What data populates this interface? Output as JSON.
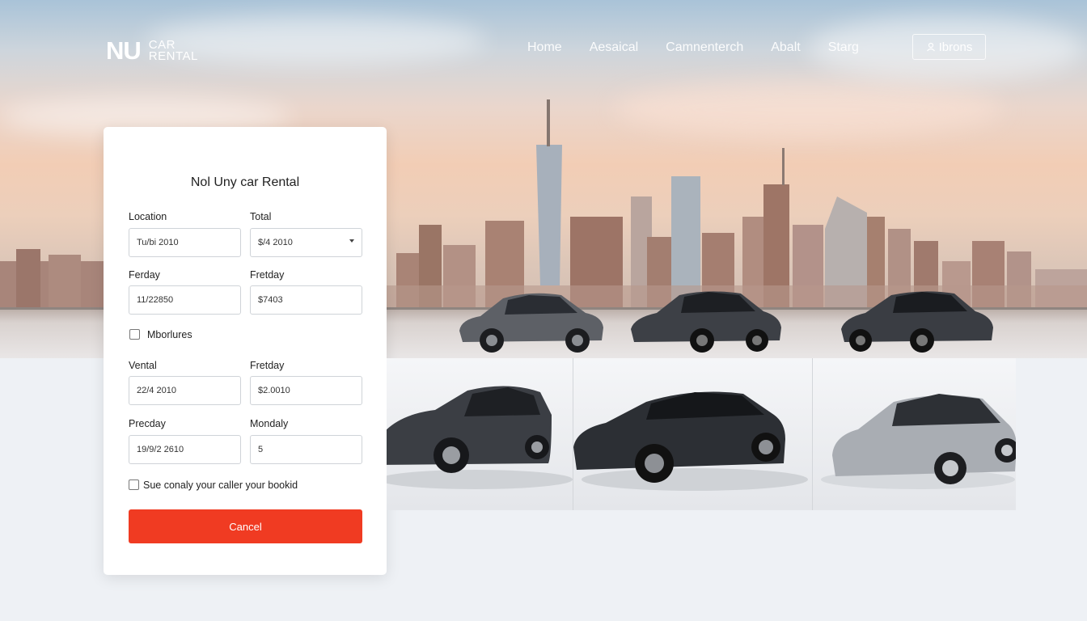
{
  "brand": {
    "mark": "NU",
    "name_line1": "CAR",
    "name_line2": "RENTAL"
  },
  "nav": {
    "items": [
      "Home",
      "Aesaical",
      "Camnenterch",
      "Abalt",
      "Starg"
    ],
    "action": "Ibrons",
    "action_icon": "user-icon"
  },
  "booking": {
    "title": "Nol Uny car Rental",
    "fields": [
      {
        "label": "Location",
        "value": "Tu/bi 2010"
      },
      {
        "label": "Total",
        "value": "$/4 2010",
        "icon": "chevron-down-icon"
      },
      {
        "label": "Ferday",
        "value": "11/22850"
      },
      {
        "label": "Fretday",
        "value": "$7403"
      },
      {
        "label": "Vental",
        "value": "22/4 2010"
      },
      {
        "label": "Fretday",
        "value": "$2.0010"
      },
      {
        "label": "Precday",
        "value": "19/9/2 2610"
      },
      {
        "label": "Mondaly",
        "value": "5"
      }
    ],
    "checkbox_1": {
      "label": "Mborlures",
      "checked": false
    },
    "checkbox_2": {
      "label": "Sue conaly your caller your bookid",
      "checked": false
    },
    "cancel_label": "Cancel"
  },
  "colors": {
    "accent": "#f03b22",
    "card": "#ffffff",
    "page_bg": "#eef1f5"
  }
}
